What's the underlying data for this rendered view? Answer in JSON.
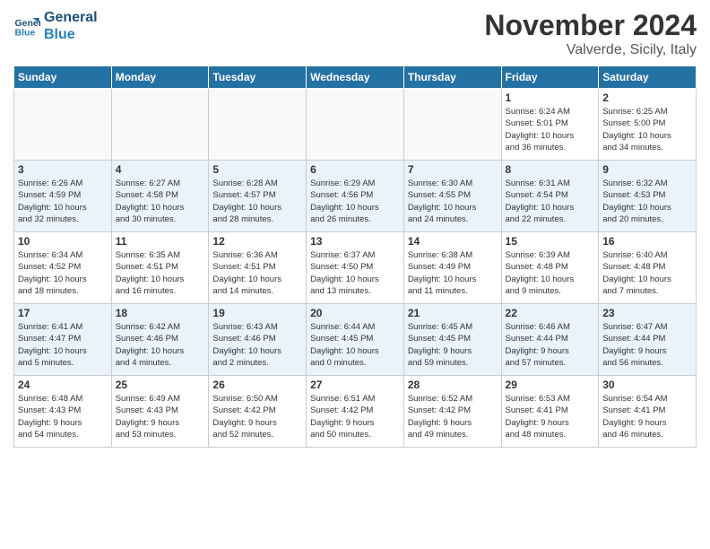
{
  "header": {
    "logo_line1": "General",
    "logo_line2": "Blue",
    "title": "November 2024",
    "location": "Valverde, Sicily, Italy"
  },
  "days_of_week": [
    "Sunday",
    "Monday",
    "Tuesday",
    "Wednesday",
    "Thursday",
    "Friday",
    "Saturday"
  ],
  "weeks": [
    [
      {
        "day": "",
        "info": "",
        "empty": true
      },
      {
        "day": "",
        "info": "",
        "empty": true
      },
      {
        "day": "",
        "info": "",
        "empty": true
      },
      {
        "day": "",
        "info": "",
        "empty": true
      },
      {
        "day": "",
        "info": "",
        "empty": true
      },
      {
        "day": "1",
        "info": "Sunrise: 6:24 AM\nSunset: 5:01 PM\nDaylight: 10 hours\nand 36 minutes."
      },
      {
        "day": "2",
        "info": "Sunrise: 6:25 AM\nSunset: 5:00 PM\nDaylight: 10 hours\nand 34 minutes."
      }
    ],
    [
      {
        "day": "3",
        "info": "Sunrise: 6:26 AM\nSunset: 4:59 PM\nDaylight: 10 hours\nand 32 minutes."
      },
      {
        "day": "4",
        "info": "Sunrise: 6:27 AM\nSunset: 4:58 PM\nDaylight: 10 hours\nand 30 minutes."
      },
      {
        "day": "5",
        "info": "Sunrise: 6:28 AM\nSunset: 4:57 PM\nDaylight: 10 hours\nand 28 minutes."
      },
      {
        "day": "6",
        "info": "Sunrise: 6:29 AM\nSunset: 4:56 PM\nDaylight: 10 hours\nand 26 minutes."
      },
      {
        "day": "7",
        "info": "Sunrise: 6:30 AM\nSunset: 4:55 PM\nDaylight: 10 hours\nand 24 minutes."
      },
      {
        "day": "8",
        "info": "Sunrise: 6:31 AM\nSunset: 4:54 PM\nDaylight: 10 hours\nand 22 minutes."
      },
      {
        "day": "9",
        "info": "Sunrise: 6:32 AM\nSunset: 4:53 PM\nDaylight: 10 hours\nand 20 minutes."
      }
    ],
    [
      {
        "day": "10",
        "info": "Sunrise: 6:34 AM\nSunset: 4:52 PM\nDaylight: 10 hours\nand 18 minutes."
      },
      {
        "day": "11",
        "info": "Sunrise: 6:35 AM\nSunset: 4:51 PM\nDaylight: 10 hours\nand 16 minutes."
      },
      {
        "day": "12",
        "info": "Sunrise: 6:36 AM\nSunset: 4:51 PM\nDaylight: 10 hours\nand 14 minutes."
      },
      {
        "day": "13",
        "info": "Sunrise: 6:37 AM\nSunset: 4:50 PM\nDaylight: 10 hours\nand 13 minutes."
      },
      {
        "day": "14",
        "info": "Sunrise: 6:38 AM\nSunset: 4:49 PM\nDaylight: 10 hours\nand 11 minutes."
      },
      {
        "day": "15",
        "info": "Sunrise: 6:39 AM\nSunset: 4:48 PM\nDaylight: 10 hours\nand 9 minutes."
      },
      {
        "day": "16",
        "info": "Sunrise: 6:40 AM\nSunset: 4:48 PM\nDaylight: 10 hours\nand 7 minutes."
      }
    ],
    [
      {
        "day": "17",
        "info": "Sunrise: 6:41 AM\nSunset: 4:47 PM\nDaylight: 10 hours\nand 5 minutes."
      },
      {
        "day": "18",
        "info": "Sunrise: 6:42 AM\nSunset: 4:46 PM\nDaylight: 10 hours\nand 4 minutes."
      },
      {
        "day": "19",
        "info": "Sunrise: 6:43 AM\nSunset: 4:46 PM\nDaylight: 10 hours\nand 2 minutes."
      },
      {
        "day": "20",
        "info": "Sunrise: 6:44 AM\nSunset: 4:45 PM\nDaylight: 10 hours\nand 0 minutes."
      },
      {
        "day": "21",
        "info": "Sunrise: 6:45 AM\nSunset: 4:45 PM\nDaylight: 9 hours\nand 59 minutes."
      },
      {
        "day": "22",
        "info": "Sunrise: 6:46 AM\nSunset: 4:44 PM\nDaylight: 9 hours\nand 57 minutes."
      },
      {
        "day": "23",
        "info": "Sunrise: 6:47 AM\nSunset: 4:44 PM\nDaylight: 9 hours\nand 56 minutes."
      }
    ],
    [
      {
        "day": "24",
        "info": "Sunrise: 6:48 AM\nSunset: 4:43 PM\nDaylight: 9 hours\nand 54 minutes."
      },
      {
        "day": "25",
        "info": "Sunrise: 6:49 AM\nSunset: 4:43 PM\nDaylight: 9 hours\nand 53 minutes."
      },
      {
        "day": "26",
        "info": "Sunrise: 6:50 AM\nSunset: 4:42 PM\nDaylight: 9 hours\nand 52 minutes."
      },
      {
        "day": "27",
        "info": "Sunrise: 6:51 AM\nSunset: 4:42 PM\nDaylight: 9 hours\nand 50 minutes."
      },
      {
        "day": "28",
        "info": "Sunrise: 6:52 AM\nSunset: 4:42 PM\nDaylight: 9 hours\nand 49 minutes."
      },
      {
        "day": "29",
        "info": "Sunrise: 6:53 AM\nSunset: 4:41 PM\nDaylight: 9 hours\nand 48 minutes."
      },
      {
        "day": "30",
        "info": "Sunrise: 6:54 AM\nSunset: 4:41 PM\nDaylight: 9 hours\nand 46 minutes."
      }
    ]
  ]
}
